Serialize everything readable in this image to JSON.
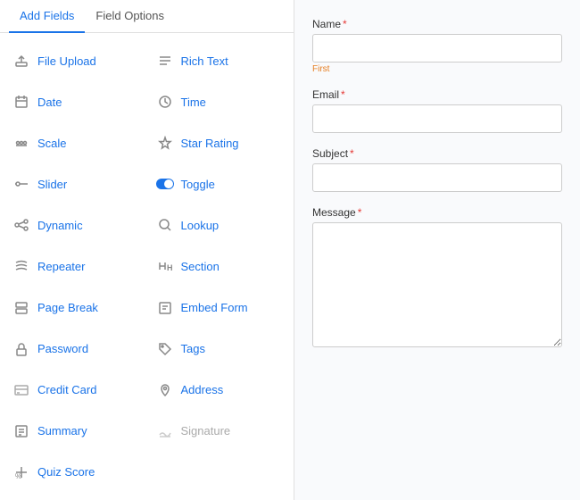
{
  "tabs": [
    {
      "id": "add-fields",
      "label": "Add Fields",
      "active": true
    },
    {
      "id": "field-options",
      "label": "Field Options",
      "active": false
    }
  ],
  "fields": [
    {
      "id": "file-upload",
      "label": "File Upload",
      "icon": "upload",
      "disabled": false,
      "col": 1
    },
    {
      "id": "rich-text",
      "label": "Rich Text",
      "icon": "lines",
      "disabled": false,
      "col": 2
    },
    {
      "id": "date",
      "label": "Date",
      "icon": "calendar",
      "disabled": false,
      "col": 1
    },
    {
      "id": "time",
      "label": "Time",
      "icon": "clock",
      "disabled": false,
      "col": 2
    },
    {
      "id": "scale",
      "label": "Scale",
      "icon": "scale",
      "disabled": false,
      "col": 1
    },
    {
      "id": "star-rating",
      "label": "Star Rating",
      "icon": "star",
      "disabled": false,
      "col": 2
    },
    {
      "id": "slider",
      "label": "Slider",
      "icon": "slider",
      "disabled": false,
      "col": 1
    },
    {
      "id": "toggle",
      "label": "Toggle",
      "icon": "toggle",
      "disabled": false,
      "col": 2
    },
    {
      "id": "dynamic",
      "label": "Dynamic",
      "icon": "dynamic",
      "disabled": false,
      "col": 1
    },
    {
      "id": "lookup",
      "label": "Lookup",
      "icon": "search",
      "disabled": false,
      "col": 2
    },
    {
      "id": "repeater",
      "label": "Repeater",
      "icon": "repeater",
      "disabled": false,
      "col": 1
    },
    {
      "id": "section",
      "label": "Section",
      "icon": "heading",
      "disabled": false,
      "col": 2
    },
    {
      "id": "page-break",
      "label": "Page Break",
      "icon": "pagebreak",
      "disabled": false,
      "col": 1
    },
    {
      "id": "embed-form",
      "label": "Embed Form",
      "icon": "embedform",
      "disabled": false,
      "col": 2
    },
    {
      "id": "password",
      "label": "Password",
      "icon": "lock",
      "disabled": false,
      "col": 1
    },
    {
      "id": "tags",
      "label": "Tags",
      "icon": "tag",
      "disabled": false,
      "col": 2
    },
    {
      "id": "credit-card",
      "label": "Credit Card",
      "icon": "creditcard",
      "disabled": false,
      "col": 1
    },
    {
      "id": "address",
      "label": "Address",
      "icon": "pin",
      "disabled": false,
      "col": 2
    },
    {
      "id": "summary",
      "label": "Summary",
      "icon": "summary",
      "disabled": false,
      "col": 1
    },
    {
      "id": "signature",
      "label": "Signature",
      "icon": "signature",
      "disabled": true,
      "col": 2
    },
    {
      "id": "quiz-score",
      "label": "Quiz Score",
      "icon": "quiz",
      "disabled": false,
      "col": 1
    }
  ],
  "form": {
    "name_label": "Name",
    "name_sublabel": "First",
    "email_label": "Email",
    "subject_label": "Subject",
    "message_label": "Message"
  }
}
